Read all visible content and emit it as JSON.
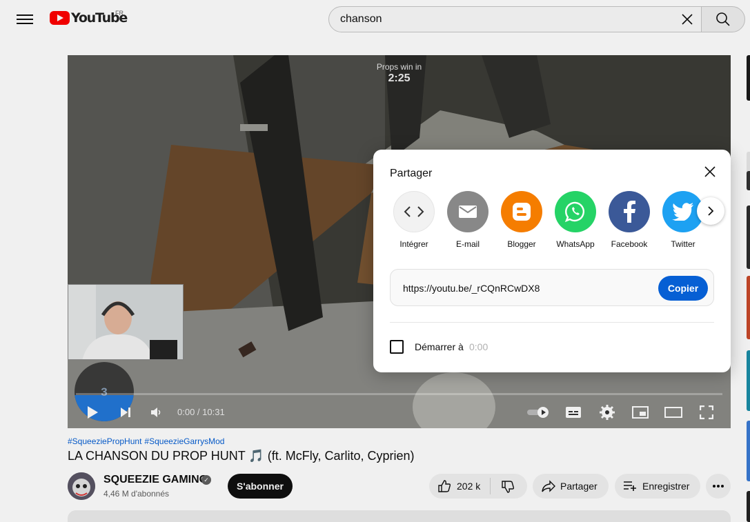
{
  "header": {
    "logo_text": "YouTube",
    "country_code": "FR",
    "search": {
      "value": "chanson"
    }
  },
  "video": {
    "overlay_label": "Props win in",
    "overlay_time": "2:25",
    "round_counter": "3",
    "time_display": "0:00 / 10:31",
    "progress": 0.0
  },
  "meta": {
    "hashtags": [
      "#SqueeziePropHunt",
      "#SqueezieGarrysMod"
    ],
    "title": "LA CHANSON DU PROP HUNT 🎵 (ft. McFly, Carlito, Cyprien)",
    "channel_name": "SQUEEZIE GAMING",
    "subscribers": "4,46 M d'abonnés",
    "subscribe_label": "S'abonner",
    "likes": "202 k",
    "share_label": "Partager",
    "save_label": "Enregistrer"
  },
  "share_dialog": {
    "title": "Partager",
    "targets": [
      {
        "label": "Intégrer",
        "icon": "embed-icon",
        "color": "#f2f2f2"
      },
      {
        "label": "E-mail",
        "icon": "email-icon",
        "color": "#888888"
      },
      {
        "label": "Blogger",
        "icon": "blogger-icon",
        "color": "#f57d00"
      },
      {
        "label": "WhatsApp",
        "icon": "whatsapp-icon",
        "color": "#25d366"
      },
      {
        "label": "Facebook",
        "icon": "facebook-icon",
        "color": "#3b5998"
      },
      {
        "label": "Twitter",
        "icon": "twitter-icon",
        "color": "#1da1f2"
      }
    ],
    "link": "https://youtu.be/_rCQnRCwDX8",
    "copy_label": "Copier",
    "start_label": "Démarrer à",
    "start_time": "0:00",
    "start_checked": false
  },
  "colors": {
    "accent": "#065fd4",
    "brand_red": "#ff0000"
  }
}
